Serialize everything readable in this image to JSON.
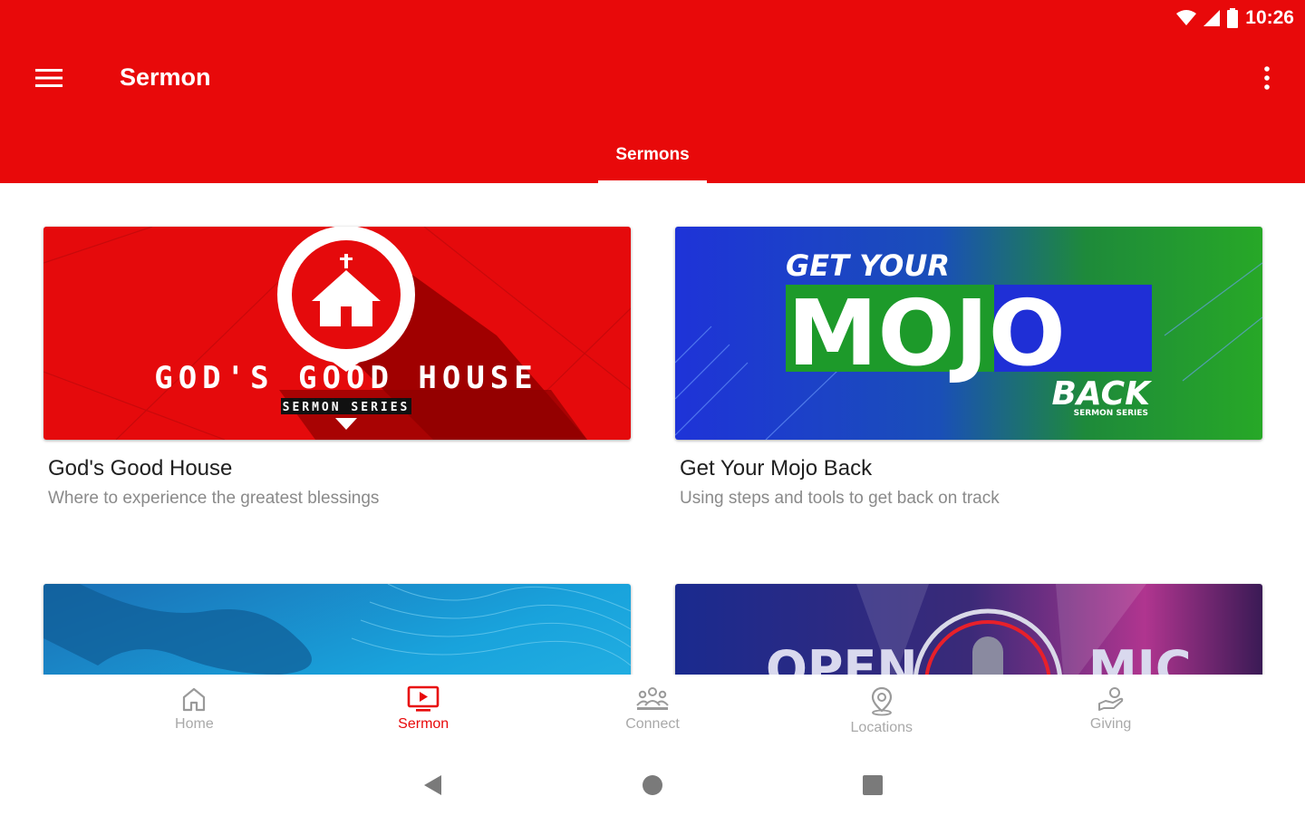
{
  "status_bar": {
    "time": "10:26"
  },
  "app_bar": {
    "title": "Sermon",
    "menu_icon": "hamburger-menu-icon",
    "more_icon": "more-vert-icon",
    "background": "#e8090a"
  },
  "tabs": [
    {
      "label": "Sermons",
      "selected": true
    }
  ],
  "cards": [
    {
      "title": "God's Good House",
      "subtitle": "Where to experience the greatest blessings",
      "art_text": "GOD'S GOOD HOUSE",
      "art_subtext": "SERMON SERIES"
    },
    {
      "title": "Get Your Mojo Back",
      "subtitle": "Using steps and tools to get back on track",
      "art_text_top": "GET YOUR",
      "art_text_main": "MOJO",
      "art_text_bottom": "BACK",
      "art_subtext": "SERMON SERIES"
    },
    {
      "title": "",
      "subtitle": ""
    },
    {
      "title": "",
      "subtitle": "",
      "art_text_left": "OPEN",
      "art_text_right": "MIC"
    }
  ],
  "bottom_nav": {
    "items": [
      {
        "label": "Home",
        "icon": "home-icon",
        "active": false
      },
      {
        "label": "Sermon",
        "icon": "tv-play-icon",
        "active": true
      },
      {
        "label": "Connect",
        "icon": "people-group-icon",
        "active": false
      },
      {
        "label": "Locations",
        "icon": "location-pin-icon",
        "active": false
      },
      {
        "label": "Giving",
        "icon": "giving-hand-icon",
        "active": false
      }
    ],
    "active_color": "#e8090a",
    "inactive_color": "#a9a9a9"
  },
  "system_nav": {
    "back_icon": "back-triangle-icon",
    "home_icon": "home-circle-icon",
    "recents_icon": "recents-square-icon"
  }
}
